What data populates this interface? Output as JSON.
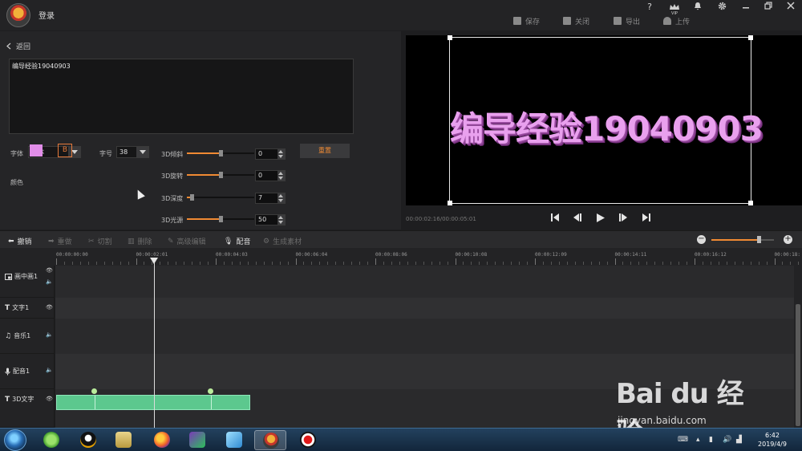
{
  "titlebar": {
    "login": "登录",
    "vip": "VIP",
    "help": "?",
    "actions": {
      "save": "保存",
      "close": "关闭",
      "export": "导出",
      "upload": "上传"
    }
  },
  "left_panel": {
    "back": "返回",
    "text_content": "编导经验19040903",
    "font_label": "字体",
    "font_value": "黑体",
    "size_label": "字号",
    "size_value": "38",
    "color_label": "颜色",
    "color": "#e18de8",
    "bold_label": "B",
    "controls": [
      {
        "label": "3D倾斜",
        "value": "0",
        "level": 0.5
      },
      {
        "label": "3D旋转",
        "value": "0",
        "level": 0.5
      },
      {
        "label": "3D深度",
        "value": "7",
        "level": 0.07
      },
      {
        "label": "3D光源",
        "value": "50",
        "level": 0.5
      }
    ],
    "reset": "重置"
  },
  "preview": {
    "text": "编导经验19040903",
    "timecode": "00:00:02:16/00:00:05:01"
  },
  "toolbar": {
    "undo": "撤销",
    "redo": "重做",
    "cut": "切割",
    "delete": "删除",
    "advanced_edit": "高级编辑",
    "dubbing": "配音",
    "generate": "生成素材",
    "zoom_level": 0.75
  },
  "ruler": {
    "labels": [
      "00:00:00:00",
      "00:00:02:01",
      "00:00:04:03",
      "00:00:06:04",
      "00:00:08:06",
      "00:00:10:08",
      "00:00:12:09",
      "00:00:14:11",
      "00:00:16:12",
      "00:00:18:"
    ]
  },
  "tracks": [
    {
      "name": "画中画1",
      "icon": "picture-in-picture-icon"
    },
    {
      "name": "文字1",
      "icon": "text-icon"
    },
    {
      "name": "音乐1",
      "icon": "music-icon"
    },
    {
      "name": "配音1",
      "icon": "microphone-icon"
    },
    {
      "name": "3D文字",
      "icon": "text-icon"
    }
  ],
  "taskbar": {
    "time": "6:42",
    "date": "2019/4/9"
  },
  "watermark": {
    "logo": "Bai du 经验",
    "url": "jingyan.baidu.com"
  },
  "colors": {
    "accent": "#f08a33",
    "clip": "#5cc88e",
    "text_color": "#e18de8"
  }
}
